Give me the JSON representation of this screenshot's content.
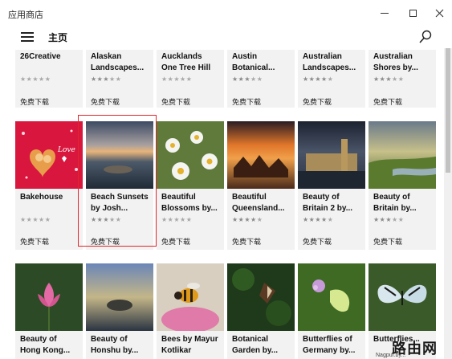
{
  "window": {
    "title": "应用商店"
  },
  "appbar": {
    "title": "主页"
  },
  "row1": [
    {
      "name": "26Creative",
      "stars": 0,
      "price": "免费下载"
    },
    {
      "name": "Alaskan Landscapes...",
      "stars": 3,
      "price": "免费下载"
    },
    {
      "name": "Aucklands One Tree Hill by I...",
      "stars": 0,
      "price": "免费下载"
    },
    {
      "name": "Austin Botanical...",
      "stars": 3,
      "price": "免费下载"
    },
    {
      "name": "Australian Landscapes...",
      "stars": 4,
      "price": "免费下载"
    },
    {
      "name": "Australian Shores by...",
      "stars": 3,
      "price": "免费下载"
    }
  ],
  "row2": [
    {
      "name": "Bakehouse",
      "stars": 0,
      "price": "免费下载",
      "thumb": "bakehouse",
      "thumb_text": "Love"
    },
    {
      "name": "Beach Sunsets by Josh...",
      "stars": 3,
      "price": "免费下载",
      "thumb": "beach"
    },
    {
      "name": "Beautiful Blossoms by...",
      "stars": 0,
      "price": "免费下载",
      "thumb": "blossoms"
    },
    {
      "name": "Beautiful Queensland...",
      "stars": 4,
      "price": "免费下载",
      "thumb": "queensland"
    },
    {
      "name": "Beauty of Britain 2 by...",
      "stars": 4,
      "price": "免费下载",
      "thumb": "britain2"
    },
    {
      "name": "Beauty of Britain by...",
      "stars": 3,
      "price": "免费下载",
      "thumb": "britain"
    }
  ],
  "row3": [
    {
      "name": "Beauty of Hong Kong...",
      "thumb": "lotus"
    },
    {
      "name": "Beauty of Honshu by...",
      "thumb": "honshu"
    },
    {
      "name": "Bees by Mayur Kotlikar",
      "thumb": "bees"
    },
    {
      "name": "Botanical Garden by...",
      "thumb": "botanical"
    },
    {
      "name": "Butterflies of Germany by...",
      "thumb": "butterflies_de"
    },
    {
      "name": "Butterflies...",
      "thumb": "butterflies"
    }
  ],
  "watermark": {
    "big": "路由网",
    "small": "Nagpur.by..."
  },
  "colors": {
    "highlight": "#e0262b",
    "card_bg": "#f2f2f2"
  }
}
